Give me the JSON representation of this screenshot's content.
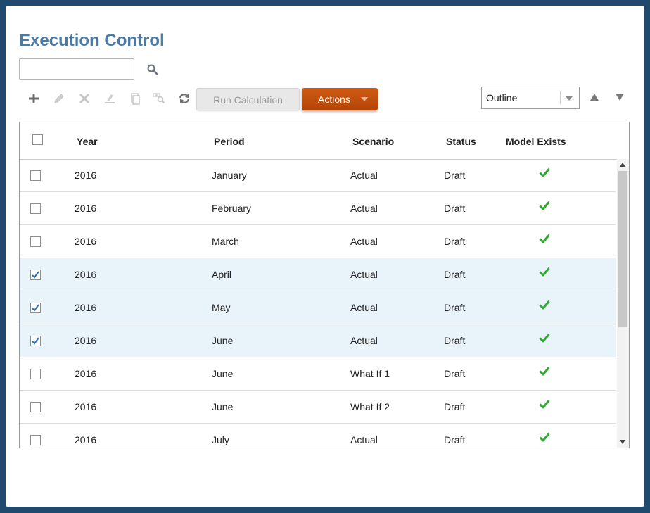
{
  "page": {
    "title": "Execution Control"
  },
  "search": {
    "value": "",
    "placeholder": ""
  },
  "toolbar": {
    "icons": [
      "add-icon",
      "edit-icon",
      "delete-icon",
      "clear-icon",
      "copy-icon",
      "filter-icon",
      "refresh-icon"
    ],
    "run_label": "Run Calculation",
    "actions_label": "Actions",
    "view_selected": "Outline"
  },
  "grid": {
    "columns": [
      "Year",
      "Period",
      "Scenario",
      "Status",
      "Model Exists"
    ],
    "rows": [
      {
        "checked": false,
        "year": "2016",
        "period": "January",
        "scenario": "Actual",
        "status": "Draft"
      },
      {
        "checked": false,
        "year": "2016",
        "period": "February",
        "scenario": "Actual",
        "status": "Draft"
      },
      {
        "checked": false,
        "year": "2016",
        "period": "March",
        "scenario": "Actual",
        "status": "Draft"
      },
      {
        "checked": true,
        "year": "2016",
        "period": "April",
        "scenario": "Actual",
        "status": "Draft"
      },
      {
        "checked": true,
        "year": "2016",
        "period": "May",
        "scenario": "Actual",
        "status": "Draft"
      },
      {
        "checked": true,
        "year": "2016",
        "period": "June",
        "scenario": "Actual",
        "status": "Draft"
      },
      {
        "checked": false,
        "year": "2016",
        "period": "June",
        "scenario": "What If 1",
        "status": "Draft"
      },
      {
        "checked": false,
        "year": "2016",
        "period": "June",
        "scenario": "What If 2",
        "status": "Draft"
      },
      {
        "checked": false,
        "year": "2016",
        "period": "July",
        "scenario": "Actual",
        "status": "Draft"
      }
    ]
  },
  "colors": {
    "title": "#4a7aa6",
    "actions": "#c4500c",
    "selected_row": "#e8f3fa",
    "check": "#2fa82f",
    "checkbox_tick": "#2a6fb0"
  }
}
